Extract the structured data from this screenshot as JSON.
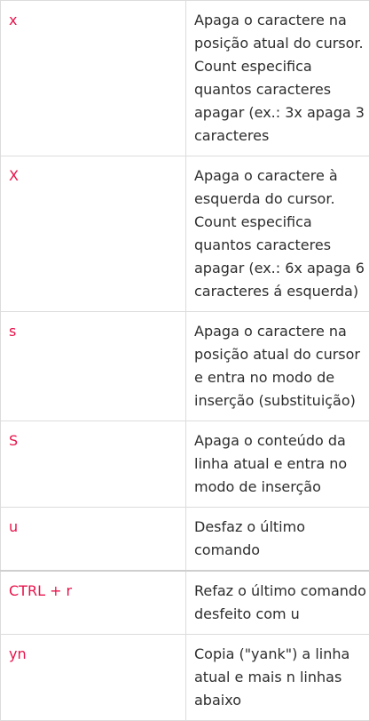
{
  "rows": [
    {
      "key": "x",
      "desc": "Apaga o caractere na posição atual do cursor. Count especifica quantos caracteres apagar (ex.: 3x apaga 3 caracteres"
    },
    {
      "key": "X",
      "desc": "Apaga o caractere à esquerda do cursor. Count especifica quantos caracteres apagar (ex.: 6x apaga 6 caracteres á esquerda)"
    },
    {
      "key": "s",
      "desc": "Apaga o caractere na posição atual do cursor e entra no modo de inserção (substituição)"
    },
    {
      "key": "S",
      "desc": "Apaga o conteúdo da linha atual e entra no modo de inserção"
    },
    {
      "key": "u",
      "desc": "Desfaz o último comando"
    },
    {
      "key": "CTRL + r",
      "desc": "Refaz o último comando desfeito com u"
    },
    {
      "key": "yn",
      "desc": "Copia (\"yank\") a linha atual e mais n linhas abaixo"
    }
  ],
  "colors": {
    "key_text": "#e8134b",
    "desc_text": "#2d2d2d",
    "border": "#dcdcdc"
  }
}
